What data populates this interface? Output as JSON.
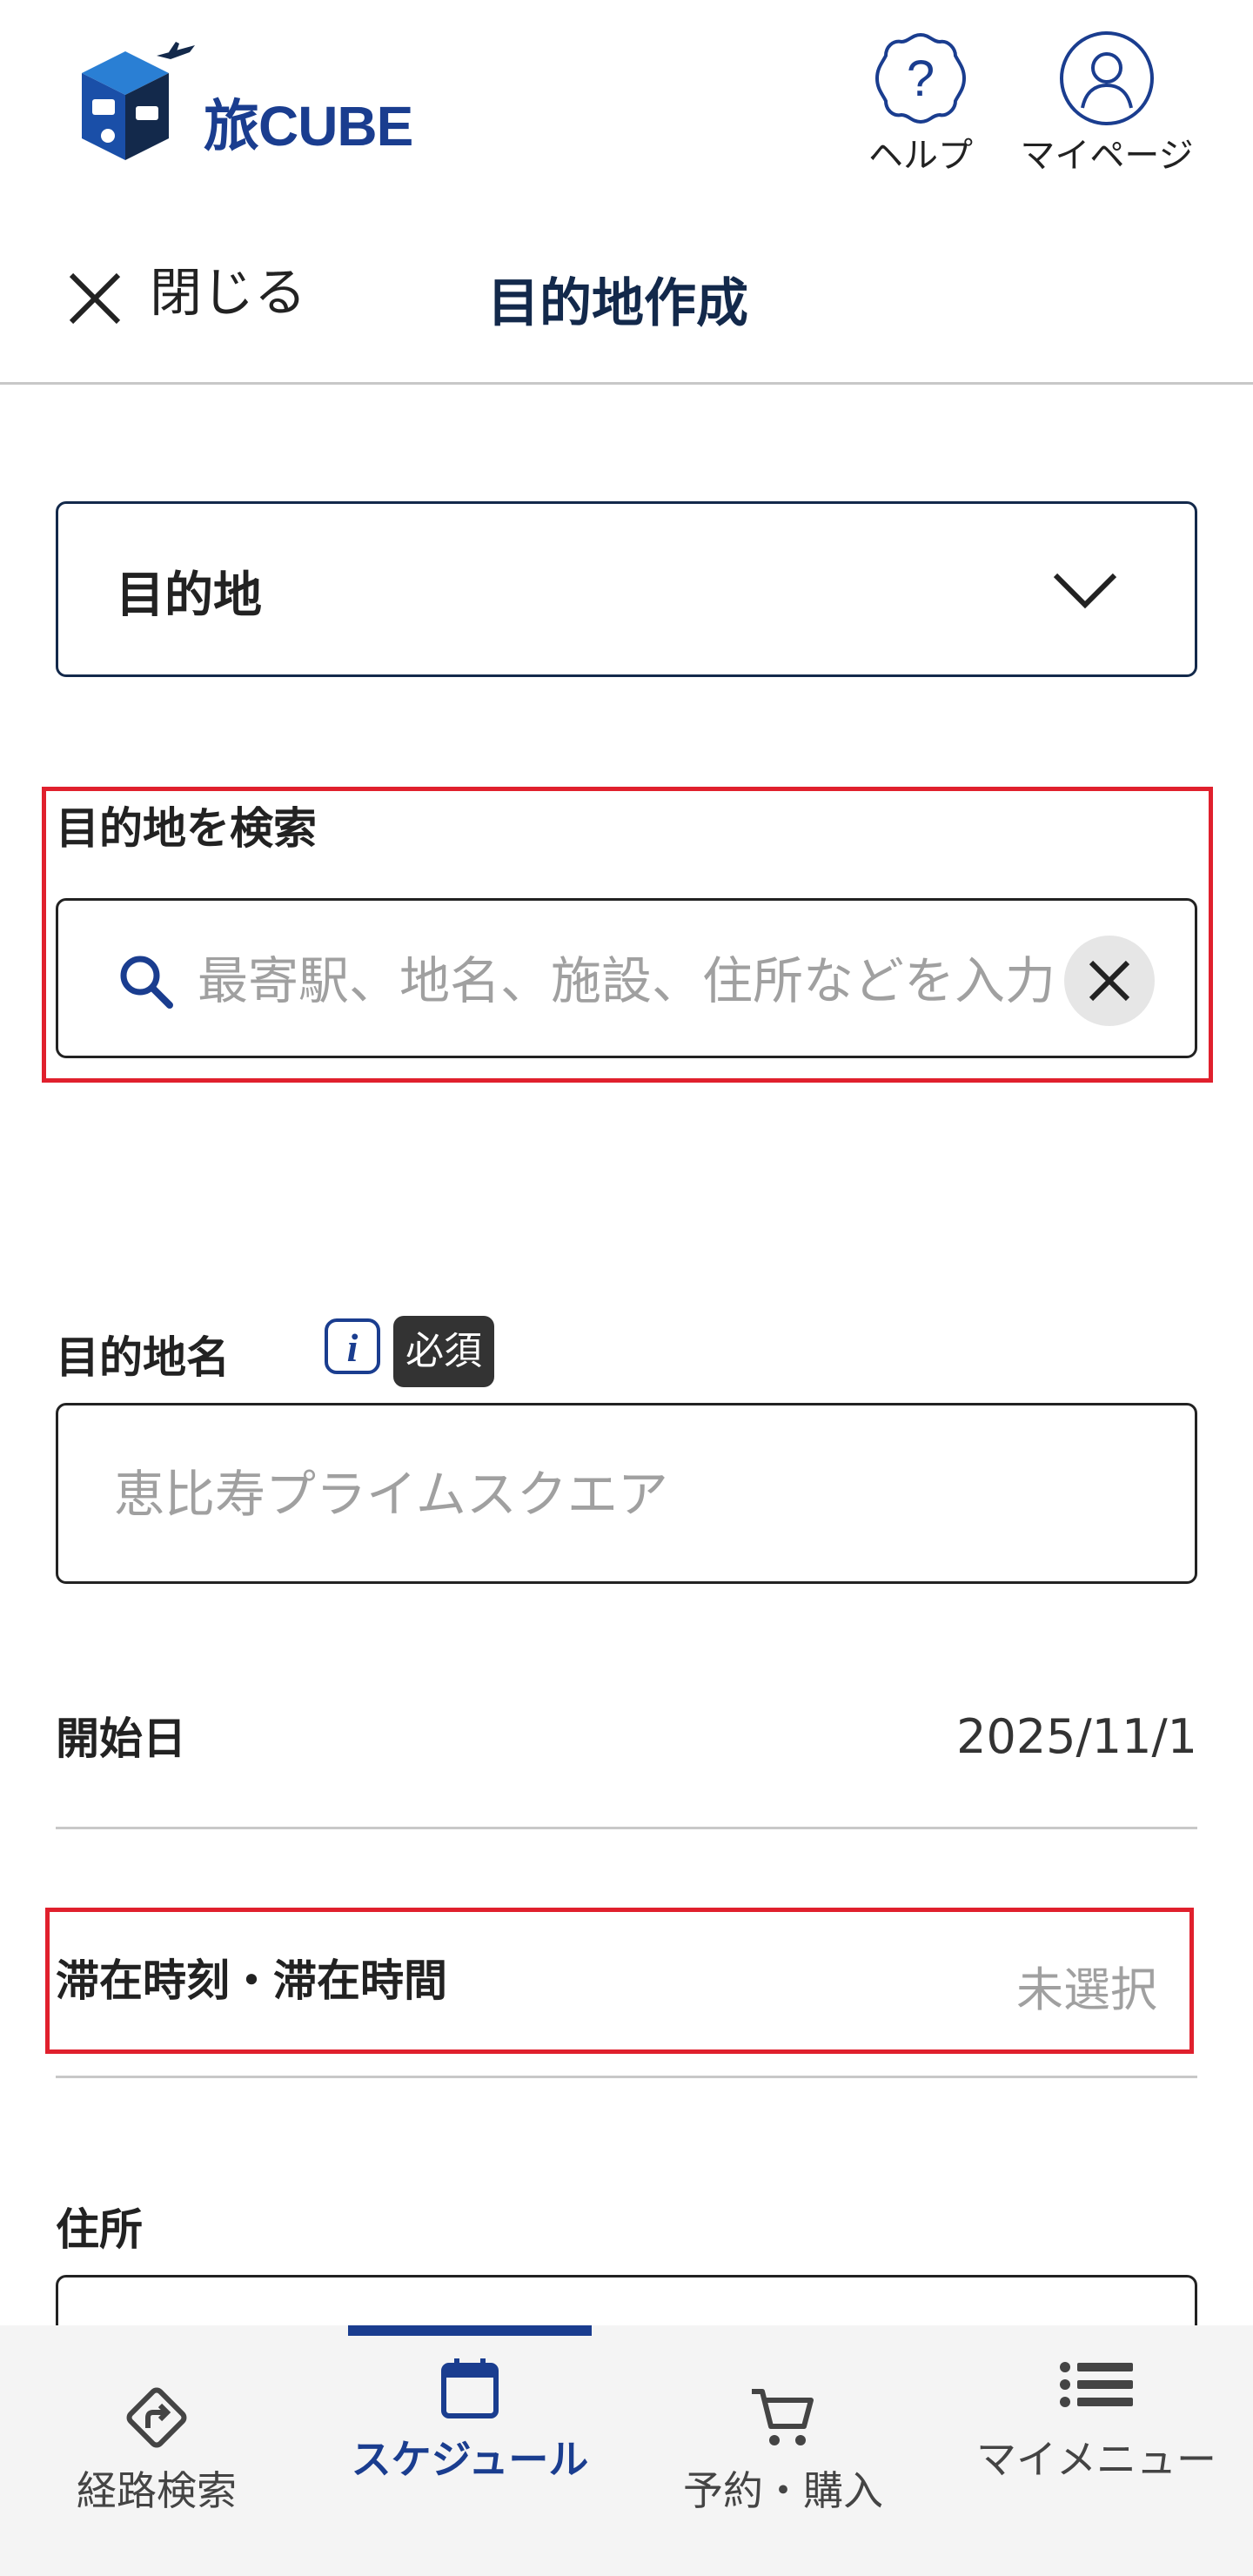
{
  "header": {
    "logo_text": "旅CUBE",
    "help_label": "ヘルプ",
    "mypage_label": "マイページ"
  },
  "subheader": {
    "close_label": "閉じる",
    "title": "目的地作成"
  },
  "form": {
    "category_select_value": "目的地",
    "search_label": "目的地を検索",
    "search_placeholder": "最寄駅、地名、施設、住所などを入力",
    "name_label": "目的地名",
    "required_badge": "必須",
    "name_placeholder": "恵比寿プライムスクエア",
    "start_date_label": "開始日",
    "start_date_value": "2025/11/1",
    "stay_label": "滞在時刻・滞在時間",
    "stay_value": "未選択",
    "address_label": "住所"
  },
  "bottom_nav": {
    "items": [
      {
        "label": "経路検索",
        "icon": "route-sign-icon",
        "active": false
      },
      {
        "label": "スケジュール",
        "icon": "calendar-icon",
        "active": true
      },
      {
        "label": "予約・購入",
        "icon": "cart-icon",
        "active": false
      },
      {
        "label": "マイメニュー",
        "icon": "list-menu-icon",
        "active": false
      }
    ]
  },
  "colors": {
    "brand_navy": "#13294b",
    "accent_blue": "#1a3d8f",
    "highlight_red": "#e0202d",
    "placeholder_gray": "#a0a0a0"
  }
}
